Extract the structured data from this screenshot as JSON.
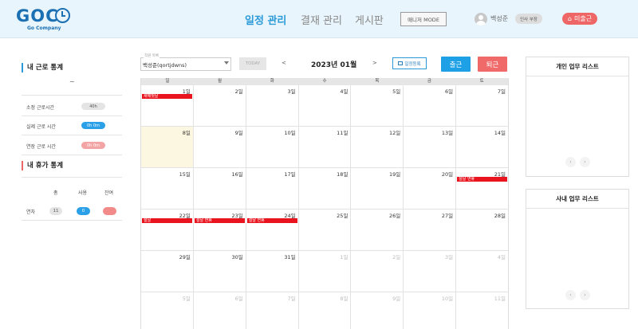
{
  "brand": {
    "logo_text": "GOC",
    "logo_sub": "Go Company"
  },
  "nav": {
    "items": [
      "일정 관리",
      "결재 관리",
      "게시판"
    ],
    "active_index": 0
  },
  "header": {
    "mode_button": "매니저 MODE",
    "user_name": "백성준",
    "dept_badge": "인사 부장",
    "status_button": "미출근",
    "status_icon": "home-icon"
  },
  "work_stats": {
    "title": "내 근로 통계",
    "range_text": "~",
    "rows": [
      {
        "label": "소정 근로시간",
        "value": "40h",
        "color": "gray"
      },
      {
        "label": "실제 근로 시간",
        "value": "0h 0m",
        "color": "blue"
      },
      {
        "label": "연장 근로 시간",
        "value": "0h 0m",
        "color": "pink"
      }
    ]
  },
  "vacation_stats": {
    "title": "내 휴가 통계",
    "headers": [
      "총",
      "사용",
      "잔여"
    ],
    "row_label": "연차",
    "total": "11",
    "used": "0",
    "remaining": ""
  },
  "toolbar": {
    "staff_label": "직원 목록",
    "staff_value": "백성준(qortjdwns)",
    "today_button": "TODAY",
    "prev_arrow": "<",
    "month_title": "2023년 01월",
    "next_arrow": ">",
    "add_schedule": "일정등록",
    "clock_in": "출근",
    "clock_out": "퇴근"
  },
  "calendar": {
    "weekdays": [
      "일",
      "월",
      "화",
      "수",
      "목",
      "금",
      "토"
    ],
    "weeks": [
      [
        {
          "day": "1일",
          "events": [
            "새해첫날"
          ]
        },
        {
          "day": "2일"
        },
        {
          "day": "3일"
        },
        {
          "day": "4일"
        },
        {
          "day": "5일"
        },
        {
          "day": "6일"
        },
        {
          "day": "7일"
        }
      ],
      [
        {
          "day": "8일",
          "today": true
        },
        {
          "day": "9일"
        },
        {
          "day": "10일"
        },
        {
          "day": "11일"
        },
        {
          "day": "12일"
        },
        {
          "day": "13일"
        },
        {
          "day": "14일"
        }
      ],
      [
        {
          "day": "15일"
        },
        {
          "day": "16일"
        },
        {
          "day": "17일"
        },
        {
          "day": "18일"
        },
        {
          "day": "19일"
        },
        {
          "day": "20일"
        },
        {
          "day": "21일",
          "events": [
            "설날 연휴"
          ]
        }
      ],
      [
        {
          "day": "22일",
          "events": [
            "설날"
          ]
        },
        {
          "day": "23일",
          "events": [
            "설날 연휴"
          ]
        },
        {
          "day": "24일",
          "events": [
            "설날 연휴"
          ]
        },
        {
          "day": "25일"
        },
        {
          "day": "26일"
        },
        {
          "day": "27일"
        },
        {
          "day": "28일"
        }
      ],
      [
        {
          "day": "29일"
        },
        {
          "day": "30일"
        },
        {
          "day": "31일"
        },
        {
          "day": "1일",
          "other": true
        },
        {
          "day": "2일",
          "other": true
        },
        {
          "day": "3일",
          "other": true
        },
        {
          "day": "4일",
          "other": true
        }
      ],
      [
        {
          "day": "5일",
          "other": true
        },
        {
          "day": "6일",
          "other": true
        },
        {
          "day": "7일",
          "other": true
        },
        {
          "day": "8일",
          "other": true
        },
        {
          "day": "9일",
          "other": true
        },
        {
          "day": "10일",
          "other": true
        },
        {
          "day": "11일",
          "other": true
        }
      ]
    ]
  },
  "panels": {
    "personal_tasks": {
      "title": "개인 업무 리스트",
      "prev": "‹",
      "next": "›"
    },
    "company_tasks": {
      "title": "사내 업무 리스트",
      "prev": "‹",
      "next": "›"
    }
  },
  "colors": {
    "accent": "#2a9ad8",
    "brand": "#1b6fb3",
    "clock_in": "#1ea0e6",
    "clock_out": "#f16a6a",
    "holiday_event": "#e9141e",
    "today_bg": "#fcf7e0"
  }
}
